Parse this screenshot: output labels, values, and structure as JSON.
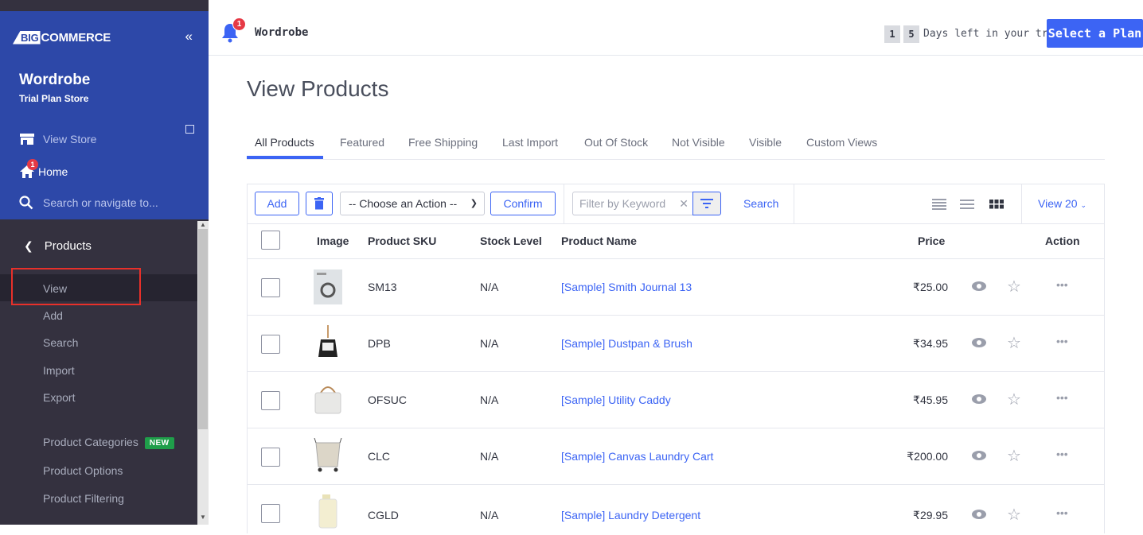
{
  "brand": {
    "logo_big": "BIG",
    "logo_rest": "COMMERCE"
  },
  "store": {
    "name": "Wordrobe",
    "plan": "Trial Plan Store"
  },
  "sidebar": {
    "view_store": "View Store",
    "home": "Home",
    "home_badge": "1",
    "search_placeholder": "Search or navigate to...",
    "section": "Products",
    "items": [
      {
        "label": "View"
      },
      {
        "label": "Add"
      },
      {
        "label": "Search"
      },
      {
        "label": "Import"
      },
      {
        "label": "Export"
      },
      {
        "label": "Product Categories",
        "badge": "NEW"
      },
      {
        "label": "Product Options"
      },
      {
        "label": "Product Filtering"
      }
    ]
  },
  "topbar": {
    "title": "Wordrobe",
    "bell_badge": "1",
    "trial_digits": [
      "1",
      "5"
    ],
    "trial_text": "Days left in your trial.",
    "plan_button": "Select a Plan"
  },
  "page": {
    "title": "View Products"
  },
  "tabs": [
    {
      "label": "All Products",
      "active": true
    },
    {
      "label": "Featured"
    },
    {
      "label": "Free Shipping"
    },
    {
      "label": "Last Import"
    },
    {
      "label": "Out Of Stock"
    },
    {
      "label": "Not Visible"
    },
    {
      "label": "Visible"
    },
    {
      "label": "Custom Views"
    }
  ],
  "toolbar": {
    "add": "Add",
    "action_select": "-- Choose an Action --",
    "confirm": "Confirm",
    "filter_placeholder": "Filter by Keyword",
    "search": "Search",
    "view_count": "View 20"
  },
  "table": {
    "headers": [
      "Image",
      "Product SKU",
      "Stock Level",
      "Product Name",
      "Price",
      "Action"
    ],
    "rows": [
      {
        "sku": "SM13",
        "stock": "N/A",
        "name": "[Sample] Smith Journal 13",
        "price": "₹25.00"
      },
      {
        "sku": "DPB",
        "stock": "N/A",
        "name": "[Sample] Dustpan & Brush",
        "price": "₹34.95"
      },
      {
        "sku": "OFSUC",
        "stock": "N/A",
        "name": "[Sample] Utility Caddy",
        "price": "₹45.95"
      },
      {
        "sku": "CLC",
        "stock": "N/A",
        "name": "[Sample] Canvas Laundry Cart",
        "price": "₹200.00"
      },
      {
        "sku": "CGLD",
        "stock": "N/A",
        "name": "[Sample] Laundry Detergent",
        "price": "₹29.95"
      }
    ]
  },
  "colors": {
    "sidebar_top": "#2d48a8",
    "sidebar_dark": "#34313f",
    "accent": "#3c64f4",
    "badge_red": "#e63945",
    "new_green": "#1f9e4a",
    "highlight": "#e8302a"
  }
}
